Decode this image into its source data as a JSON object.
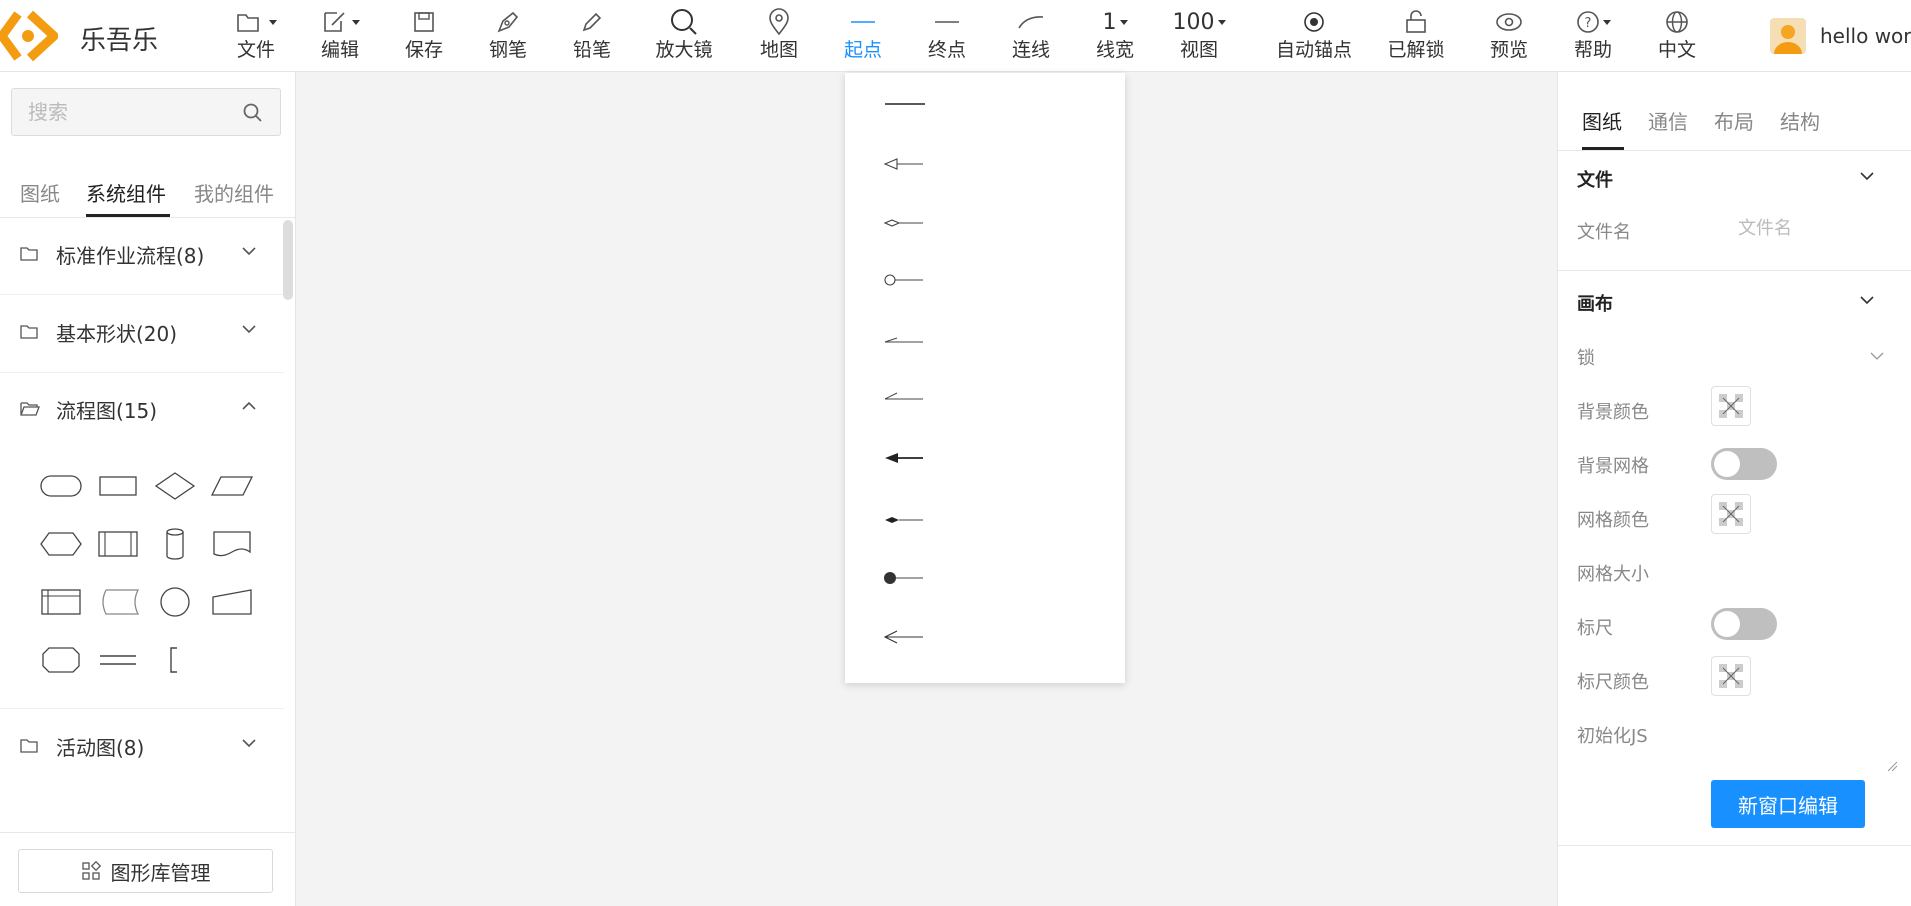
{
  "app": {
    "brand": "乐吾乐"
  },
  "toolbar": [
    {
      "label": "文件",
      "icon": "file-icon"
    },
    {
      "label": "编辑",
      "icon": "edit-icon"
    },
    {
      "label": "保存",
      "icon": "save-icon"
    },
    {
      "label": "钢笔",
      "icon": "pen-icon"
    },
    {
      "label": "铅笔",
      "icon": "pencil-icon"
    },
    {
      "label": "放大镜",
      "icon": "magnifier-icon"
    },
    {
      "label": "地图",
      "icon": "map-pin-icon"
    },
    {
      "label": "起点",
      "icon": "line-start-icon",
      "active": true
    },
    {
      "label": "终点",
      "icon": "line-end-icon"
    },
    {
      "label": "连线",
      "icon": "curve-icon"
    },
    {
      "label": "线宽",
      "value": "1"
    },
    {
      "label": "视图",
      "value": "100"
    },
    {
      "label": "自动锚点",
      "icon": "anchor-icon"
    },
    {
      "label": "已解锁",
      "icon": "unlock-icon"
    },
    {
      "label": "预览",
      "icon": "eye-icon"
    },
    {
      "label": "帮助",
      "icon": "help-icon"
    },
    {
      "label": "中文",
      "icon": "globe-icon"
    }
  ],
  "user": {
    "name": "hello world"
  },
  "sidebar": {
    "search_placeholder": "搜索",
    "tabs": [
      "图纸",
      "系统组件",
      "我的组件"
    ],
    "active_tab": "系统组件",
    "categories": [
      {
        "label": "标准作业流程(8)",
        "expanded": false
      },
      {
        "label": "基本形状(20)",
        "expanded": false
      },
      {
        "label": "流程图(15)",
        "expanded": true
      },
      {
        "label": "活动图(8)",
        "expanded": false
      }
    ],
    "library_button": "图形库管理"
  },
  "line_start_menu": [
    "none",
    "triangle-hollow",
    "diamond-hollow",
    "circle-hollow",
    "half-line-top",
    "half-line-bottom",
    "triangle-solid",
    "diamond-solid",
    "circle-solid",
    "open-arrow"
  ],
  "panel": {
    "tabs": [
      "图纸",
      "通信",
      "布局",
      "结构"
    ],
    "active_tab": "图纸",
    "file_section": {
      "title": "文件",
      "filename_label": "文件名",
      "filename_placeholder": "文件名"
    },
    "canvas_section": {
      "title": "画布",
      "lock_label": "锁",
      "bg_color_label": "背景颜色",
      "bg_grid_label": "背景网格",
      "grid_color_label": "网格颜色",
      "grid_size_label": "网格大小",
      "ruler_label": "标尺",
      "ruler_color_label": "标尺颜色",
      "init_js_label": "初始化JS",
      "edit_button": "新窗口编辑"
    },
    "bg_grid_on": false,
    "ruler_on": false
  },
  "colors": {
    "brand": "#f39c12",
    "accent": "#1890ff"
  }
}
